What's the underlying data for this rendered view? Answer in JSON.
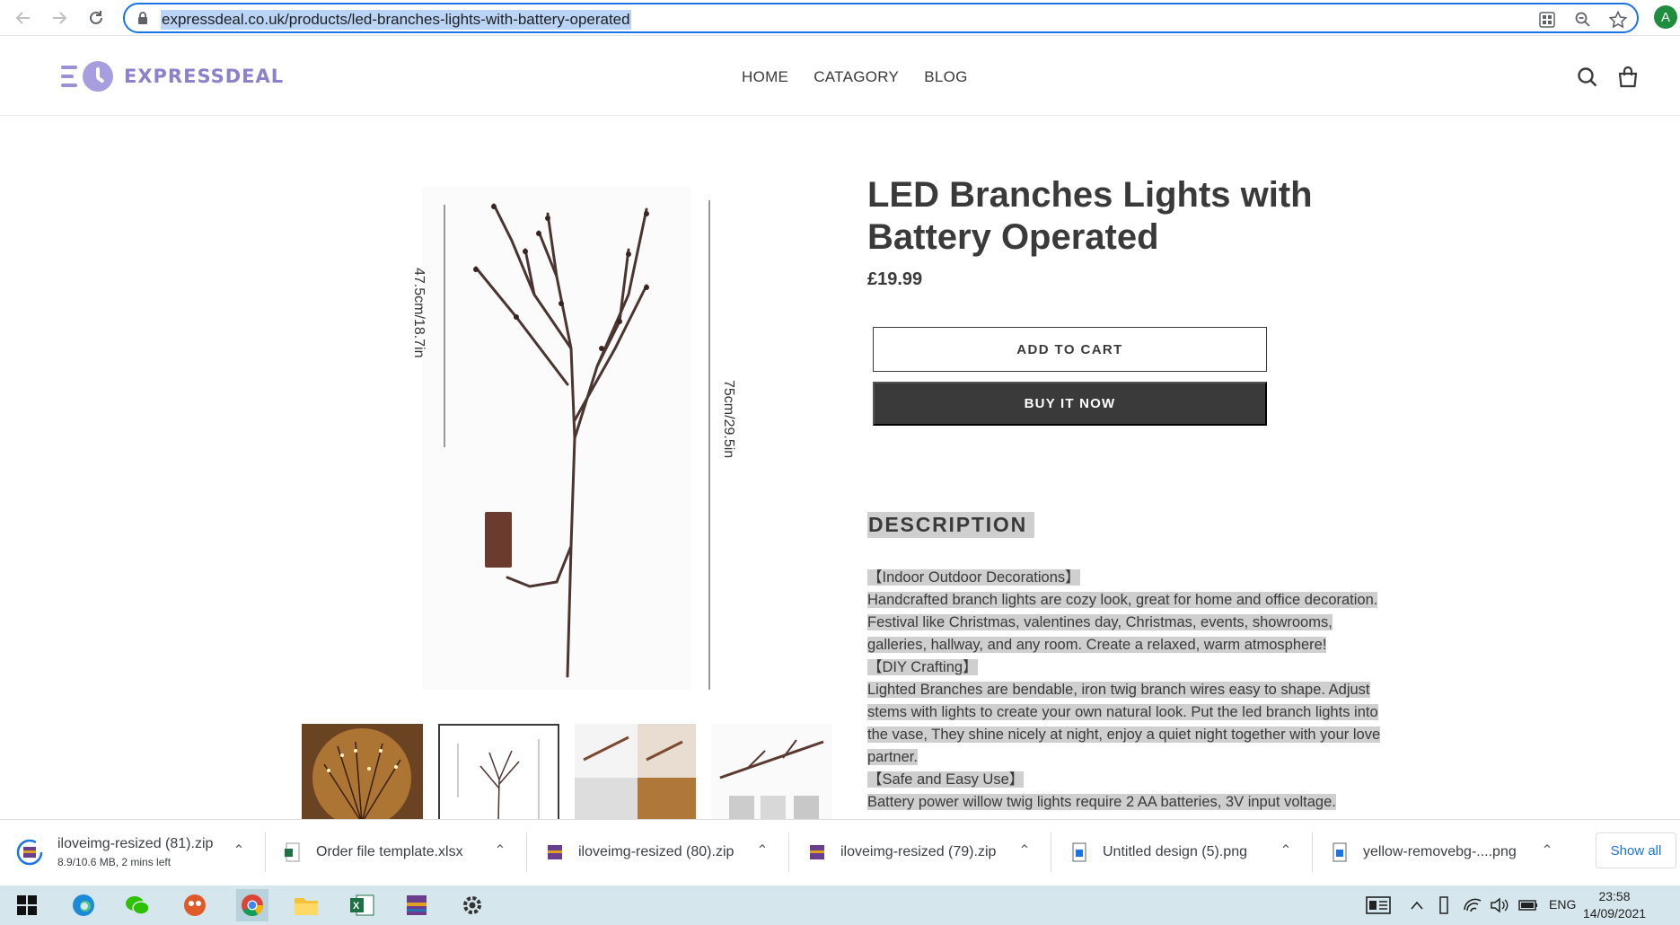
{
  "browser": {
    "url": "expressdeal.co.uk/products/led-branches-lights-with-battery-operated",
    "profile_initial": "A"
  },
  "site": {
    "logo_text": "EXPRESSDEAL",
    "nav": [
      "HOME",
      "CATAGORY",
      "BLOG"
    ]
  },
  "product": {
    "title": "LED Branches Lights with Battery Operated",
    "price": "£19.99",
    "add_to_cart": "ADD TO CART",
    "buy_now": "BUY IT NOW",
    "image_labels": {
      "short": "47.5cm/18.7in",
      "long": "75cm/29.5in"
    },
    "description_heading": "DESCRIPTION",
    "description": [
      "【Indoor Outdoor Decorations】",
      "Handcrafted branch lights are cozy look, great for home and office decoration.",
      "Festival like Christmas, valentines day, Christmas, events, showrooms,",
      "galleries, hallway, and any room. Create a relaxed, warm atmosphere!",
      "【DIY Crafting】",
      "Lighted Branches are bendable, iron twig branch wires easy to shape. Adjust",
      "stems with lights to create your own natural look. Put the led branch lights into",
      "the vase, They shine nicely at night, enjoy a quiet night together with your love",
      "partner.",
      "【Safe and Easy Use】",
      "Battery power willow twig lights require 2 AA batteries, 3V input voltage."
    ]
  },
  "downloads": {
    "items": [
      {
        "name": "iloveimg-resized (81).zip",
        "status": "8.9/10.6 MB, 2 mins left"
      },
      {
        "name": "Order file template.xlsx"
      },
      {
        "name": "iloveimg-resized (80).zip"
      },
      {
        "name": "iloveimg-resized (79).zip"
      },
      {
        "name": "Untitled design (5).png"
      },
      {
        "name": "yellow-removebg-....png"
      }
    ],
    "show_all": "Show all"
  },
  "taskbar": {
    "language": "ENG",
    "time": "23:58",
    "date": "14/09/2021"
  },
  "colors": {
    "accent": "#1a73e8",
    "logo": "#8c82cc",
    "dark_button": "#3a3a3a",
    "selection": "#cfcfcf"
  }
}
